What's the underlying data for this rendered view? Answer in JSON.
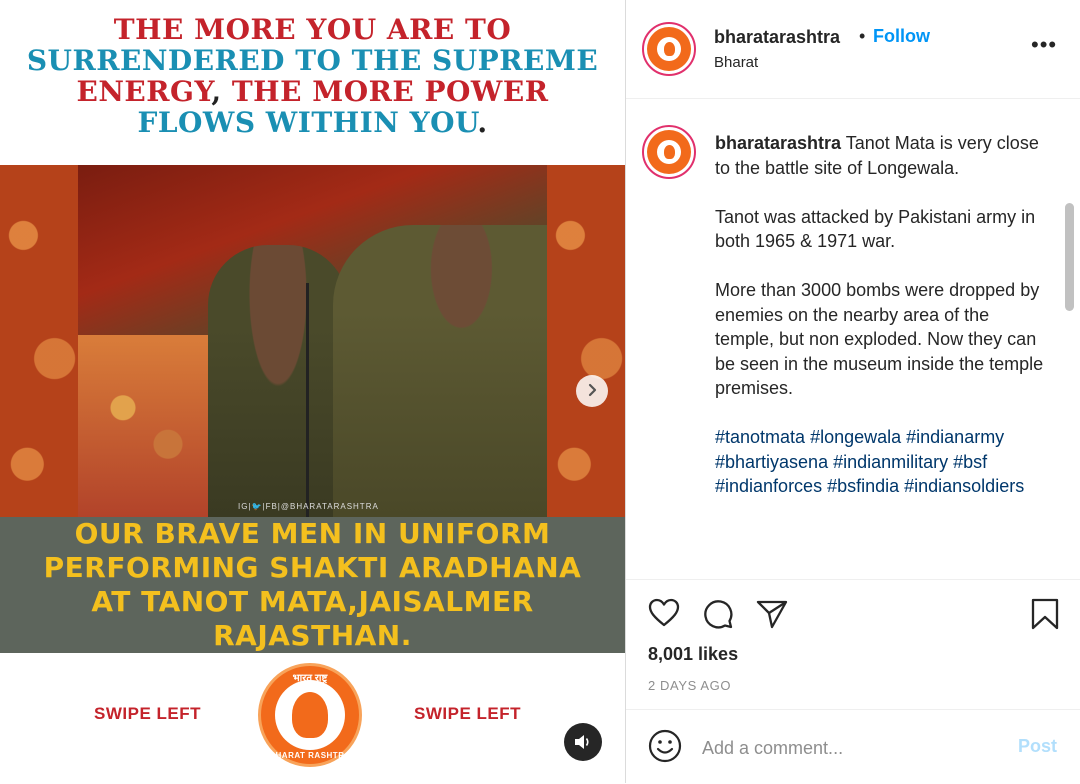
{
  "post_image": {
    "headline": {
      "line1": "THE MORE YOU ARE TO",
      "line2": "SURRENDERED TO THE SUPREME",
      "line3_part1": "ENERGY",
      "line3_part2": ", ",
      "line3_part3": "THE MORE POWER",
      "line4": "FLOWS WITHIN YOU",
      "line4_end": "."
    },
    "watermark": "IG|🐦|FB|@BHARATARASHTRA",
    "caption_lines": [
      "OUR BRAVE MEN IN UNIFORM",
      "PERFORMING SHAKTI ARADHANA",
      "AT TANOT MATA,JAISALMER",
      "RAJASTHAN."
    ],
    "swipe_left_label": "SWIPE LEFT",
    "swipe_right_label": "SWIPE LEFT",
    "logo_top_text": "भारत राष्ट्र",
    "logo_bottom_text": "BHARAT RASHTRA",
    "next_icon": "chevron-right-icon",
    "sound_icon": "speaker-icon"
  },
  "header": {
    "username": "bharatarashtra",
    "separator": "•",
    "follow_label": "Follow",
    "location": "Bharat",
    "more_icon": "more-horizontal-icon",
    "more_label": "•••"
  },
  "caption": {
    "username": "bharatarashtra",
    "text_p1": "Tanot Mata is very close to the battle site of Longewala.",
    "text_p2": "Tanot was attacked by Pakistani army in both 1965 & 1971 war.",
    "text_p3": "More than 3000 bombs were dropped by enemies on the nearby area of the temple, but non exploded. Now they can be seen in the museum inside the temple premises.",
    "hashtags": "#tanotmata #longewala #indianarmy #bhartiyasena #indianmilitary #bsf #indianforces #bsfindia #indiansoldiers"
  },
  "actions": {
    "like_icon": "heart-icon",
    "comment_icon": "comment-icon",
    "share_icon": "paper-plane-icon",
    "save_icon": "bookmark-icon",
    "likes": "8,001 likes",
    "date": "2 DAYS AGO"
  },
  "add_comment": {
    "emoji_icon": "emoji-icon",
    "placeholder": "Add a comment...",
    "post_label": "Post"
  },
  "colors": {
    "follow": "#0095f6",
    "post_disabled": "#b2dffc",
    "hashtag": "#00376b",
    "headline_red": "#c4232b",
    "headline_teal": "#1a8fb3",
    "caption_yellow": "#f4c01e",
    "brand_orange": "#f26a1b"
  }
}
